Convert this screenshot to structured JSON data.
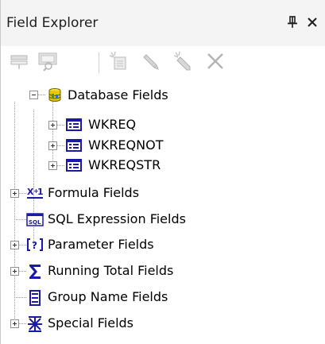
{
  "window": {
    "title": "Field Explorer",
    "pin_icon": "pin-icon",
    "close_icon": "close-icon"
  },
  "toolbar": {
    "items": [
      {
        "name": "insert-to-report",
        "icon": "insert-icon",
        "enabled": false
      },
      {
        "name": "browse-data",
        "icon": "browse-icon",
        "enabled": false
      },
      {
        "name": "new",
        "icon": "new-icon",
        "enabled": false
      },
      {
        "name": "edit",
        "icon": "pencil-icon",
        "enabled": false
      },
      {
        "name": "rename",
        "icon": "rename-icon",
        "enabled": false
      },
      {
        "name": "delete",
        "icon": "delete-icon",
        "enabled": false
      }
    ]
  },
  "tree": {
    "database_fields": {
      "label": "Database Fields",
      "icon": "database-icon",
      "expanded": true,
      "children": [
        {
          "label": "WKREQ",
          "icon": "table-icon"
        },
        {
          "label": "WKREQNOT",
          "icon": "table-icon"
        },
        {
          "label": "WKREQSTR",
          "icon": "table-icon"
        }
      ]
    },
    "formula_fields": {
      "label": "Formula Fields",
      "icon": "formula-icon"
    },
    "sql_expression_fields": {
      "label": "SQL Expression Fields",
      "icon": "sql-icon"
    },
    "parameter_fields": {
      "label": "Parameter Fields",
      "icon": "parameter-icon"
    },
    "running_total_fields": {
      "label": "Running Total Fields",
      "icon": "sigma-icon"
    },
    "group_name_fields": {
      "label": "Group Name Fields",
      "icon": "group-name-icon"
    },
    "special_fields": {
      "label": "Special Fields",
      "icon": "special-icon"
    }
  },
  "colors": {
    "titlebar_bg": "#f4f4f4",
    "disabled_icon": "#b8b8b8",
    "tree_icon_blue": "#1a1aa8",
    "database_yellow": "#e8c800"
  }
}
